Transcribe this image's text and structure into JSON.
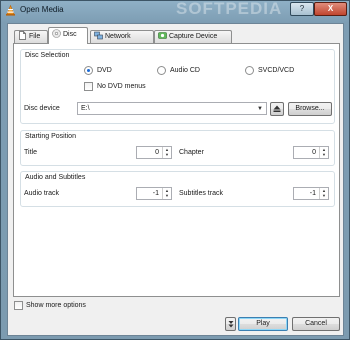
{
  "window": {
    "title": "Open Media",
    "watermark": "SOFTPEDIA",
    "help_button": "?",
    "close_button": "X"
  },
  "tabs": [
    {
      "label": "File"
    },
    {
      "label": "Disc"
    },
    {
      "label": "Network"
    },
    {
      "label": "Capture Device"
    }
  ],
  "disc_selection": {
    "title": "Disc Selection",
    "options": [
      {
        "label": "DVD",
        "selected": true
      },
      {
        "label": "Audio CD",
        "selected": false
      },
      {
        "label": "SVCD/VCD",
        "selected": false
      }
    ],
    "no_menus_label": "No DVD menus",
    "no_menus_checked": false,
    "device_label": "Disc device",
    "device_value": "E:\\",
    "browse_label": "Browse..."
  },
  "starting_position": {
    "title": "Starting Position",
    "title_label": "Title",
    "title_value": "0",
    "chapter_label": "Chapter",
    "chapter_value": "0"
  },
  "audio_subtitles": {
    "title": "Audio and Subtitles",
    "audio_label": "Audio track",
    "audio_value": "-1",
    "subtitles_label": "Subtitles track",
    "subtitles_value": "-1"
  },
  "footer": {
    "show_more_label": "Show more options",
    "show_more_checked": false,
    "play_label": "Play",
    "cancel_label": "Cancel"
  }
}
